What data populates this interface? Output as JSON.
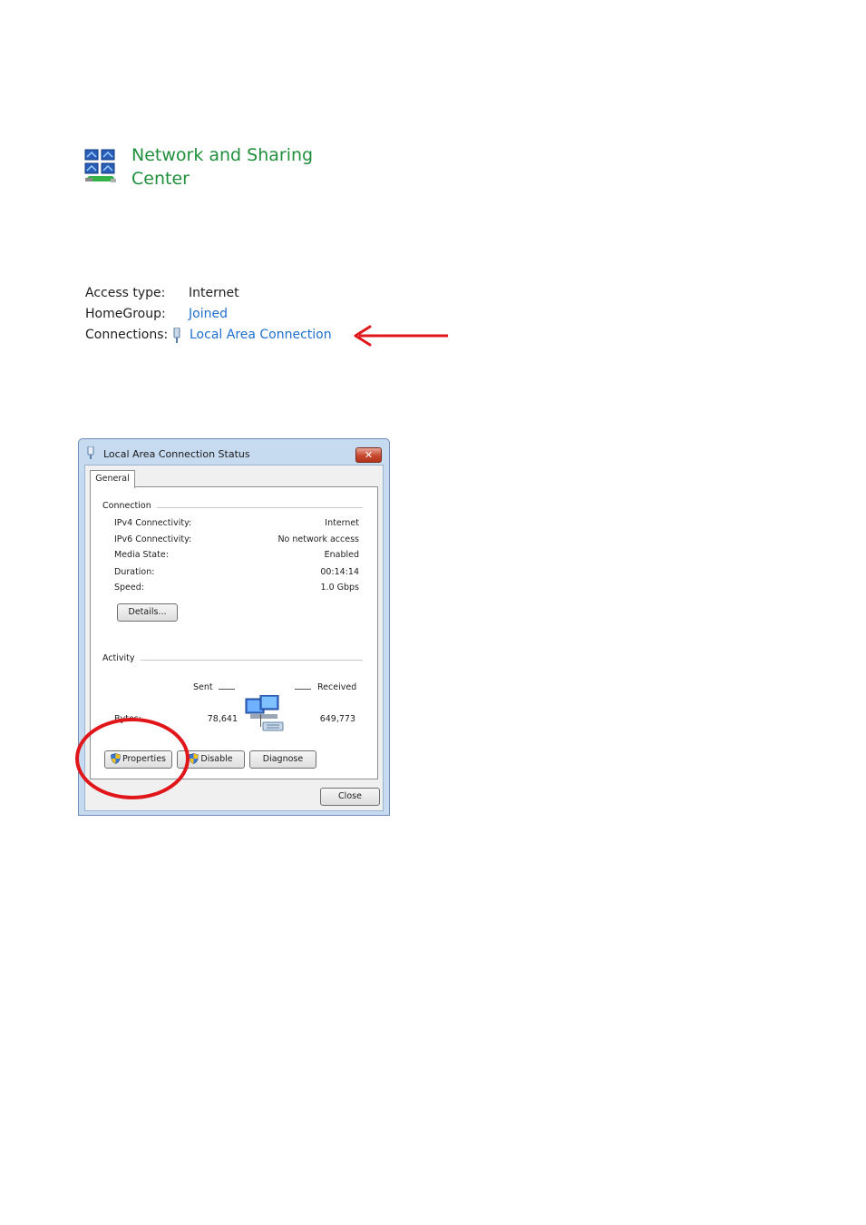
{
  "network_center": {
    "title": "Network and Sharing Center",
    "icon": "network-computers-icon"
  },
  "info": {
    "access_type_label": "Access type:",
    "access_type_value": "Internet",
    "homegroup_label": "HomeGroup:",
    "homegroup_value": "Joined",
    "connections_label": "Connections:",
    "connections_value": "Local Area Connection",
    "connections_icon": "network-plug-icon"
  },
  "annotations": {
    "arrow_color": "#e0161b",
    "circle_color": "#e0161b"
  },
  "dialog": {
    "title": "Local Area Connection Status",
    "tab": "General",
    "connection_group": "Connection",
    "connection_rows": [
      {
        "label": "IPv4 Connectivity:",
        "value": "Internet"
      },
      {
        "label": "IPv6 Connectivity:",
        "value": "No network access"
      },
      {
        "label": "Media State:",
        "value": "Enabled"
      },
      {
        "label": "Duration:",
        "value": "00:14:14"
      },
      {
        "label": "Speed:",
        "value": "1.0 Gbps"
      }
    ],
    "details_button": "Details...",
    "activity_group": "Activity",
    "sent_label": "Sent",
    "received_label": "Received",
    "bytes_label": "Bytes:",
    "bytes_sent": "78,641",
    "bytes_received": "649,773",
    "properties_button": "Properties",
    "disable_button": "Disable",
    "diagnose_button": "Diagnose",
    "close_button": "Close"
  }
}
